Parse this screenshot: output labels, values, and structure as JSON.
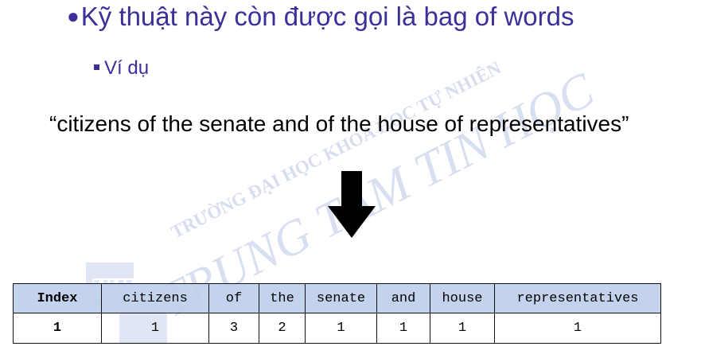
{
  "heading": {
    "bullet": "●",
    "text": "Kỹ thuật này còn được gọi là bag of words"
  },
  "subheading": {
    "text": "Ví dụ"
  },
  "example_sentence": "“citizens of the senate and of the house of representatives”",
  "table": {
    "header": [
      "Index",
      "citizens",
      "of",
      "the",
      "senate",
      "and",
      "house",
      "representatives"
    ],
    "row": [
      "1",
      "1",
      "3",
      "2",
      "1",
      "1",
      "1",
      "1"
    ]
  },
  "watermark": {
    "line1": "TRƯỜNG ĐẠI HỌC KHOA HỌC TỰ NHIÊN",
    "line2": "TRUNG TÂM TIN HỌC",
    "logo": "TT TH"
  },
  "colors": {
    "heading_text": "#3b2f9a",
    "table_header_bg": "#bfcfec",
    "watermark": "#c8d2ea"
  },
  "icons": {
    "arrow": "arrow-down-icon"
  }
}
